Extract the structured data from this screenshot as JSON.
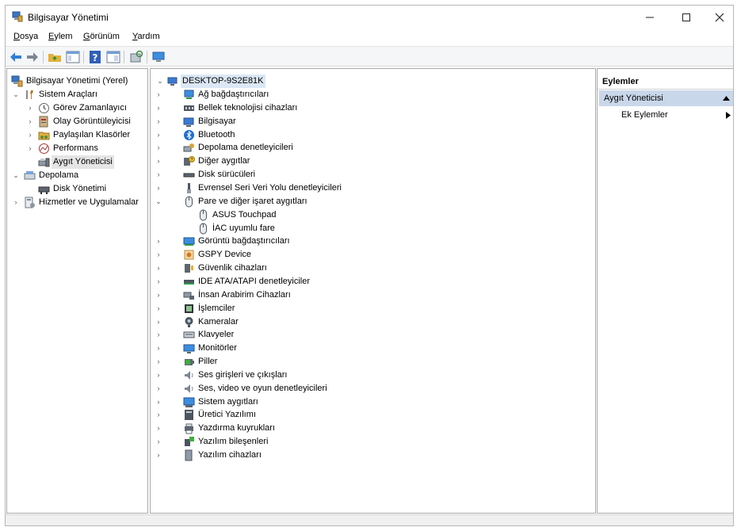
{
  "window": {
    "title": "Bilgisayar Yönetimi"
  },
  "menubar": [
    {
      "label": "Dosya",
      "mn": "D",
      "rest": "osya"
    },
    {
      "label": "Eylem",
      "mn": "E",
      "rest": "ylem"
    },
    {
      "label": "Görünüm",
      "mn": "G",
      "rest": "örünüm"
    },
    {
      "label": "Yardım",
      "mn": "Y",
      "rest": "ardım"
    }
  ],
  "left_tree": [
    {
      "label": "Bilgisayar Yönetimi (Yerel)",
      "icon": "computer-management-icon",
      "chev": "",
      "level": 0
    },
    {
      "label": "Sistem Araçları",
      "icon": "system-tools-icon",
      "chev": "v",
      "level": 1
    },
    {
      "label": "Görev Zamanlayıcı",
      "icon": "task-scheduler-icon",
      "chev": ">",
      "level": 2
    },
    {
      "label": "Olay Görüntüleyicisi",
      "icon": "event-viewer-icon",
      "chev": ">",
      "level": 2
    },
    {
      "label": "Paylaşılan Klasörler",
      "icon": "shared-folders-icon",
      "chev": ">",
      "level": 2
    },
    {
      "label": "Performans",
      "icon": "performance-icon",
      "chev": ">",
      "level": 2
    },
    {
      "label": "Aygıt Yöneticisi",
      "icon": "device-manager-icon",
      "chev": "",
      "level": 2,
      "selected": true
    },
    {
      "label": "Depolama",
      "icon": "storage-icon",
      "chev": "v",
      "level": 1
    },
    {
      "label": "Disk Yönetimi",
      "icon": "disk-management-icon",
      "chev": "",
      "level": 2
    },
    {
      "label": "Hizmetler ve Uygulamalar",
      "icon": "services-apps-icon",
      "chev": ">",
      "level": 1
    }
  ],
  "device_tree": {
    "root": {
      "label": "DESKTOP-9S2E81K",
      "icon": "computer-icon"
    },
    "items": [
      {
        "label": "Ağ bağdaştırıcıları",
        "icon": "network-adapter-icon",
        "chev": ">"
      },
      {
        "label": "Bellek teknolojisi cihazları",
        "icon": "memory-tech-icon",
        "chev": ">"
      },
      {
        "label": "Bilgisayar",
        "icon": "computer-icon",
        "chev": ">"
      },
      {
        "label": "Bluetooth",
        "icon": "bluetooth-icon",
        "chev": ">"
      },
      {
        "label": "Depolama denetleyicileri",
        "icon": "storage-controller-icon",
        "chev": ">"
      },
      {
        "label": "Diğer aygıtlar",
        "icon": "other-devices-icon",
        "chev": ">"
      },
      {
        "label": "Disk sürücüleri",
        "icon": "disk-drive-icon",
        "chev": ">"
      },
      {
        "label": "Evrensel Seri Veri Yolu denetleyicileri",
        "icon": "usb-icon",
        "chev": ">"
      },
      {
        "label": "Pare ve diğer işaret aygıtları",
        "icon": "mouse-icon",
        "chev": "v"
      },
      {
        "label": "ASUS Touchpad",
        "icon": "mouse-icon",
        "chev": "",
        "child": true
      },
      {
        "label": "İAC uyumlu fare",
        "icon": "mouse-icon",
        "chev": "",
        "child": true
      },
      {
        "label": "Görüntü bağdaştırıcıları",
        "icon": "display-adapter-icon",
        "chev": ">"
      },
      {
        "label": "GSPY Device",
        "icon": "gspy-device-icon",
        "chev": ">"
      },
      {
        "label": "Güvenlik cihazları",
        "icon": "security-device-icon",
        "chev": ">"
      },
      {
        "label": "IDE ATA/ATAPI denetleyiciler",
        "icon": "ide-controller-icon",
        "chev": ">"
      },
      {
        "label": "İnsan Arabirim Cihazları",
        "icon": "hid-icon",
        "chev": ">"
      },
      {
        "label": "İşlemciler",
        "icon": "processor-icon",
        "chev": ">"
      },
      {
        "label": "Kameralar",
        "icon": "camera-icon",
        "chev": ">"
      },
      {
        "label": "Klavyeler",
        "icon": "keyboard-icon",
        "chev": ">"
      },
      {
        "label": "Monitörler",
        "icon": "monitor-icon",
        "chev": ">"
      },
      {
        "label": "Piller",
        "icon": "battery-icon",
        "chev": ">"
      },
      {
        "label": "Ses girişleri ve çıkışları",
        "icon": "audio-io-icon",
        "chev": ">"
      },
      {
        "label": "Ses, video ve oyun denetleyicileri",
        "icon": "sound-video-icon",
        "chev": ">"
      },
      {
        "label": "Sistem aygıtları",
        "icon": "system-devices-icon",
        "chev": ">"
      },
      {
        "label": "Üretici Yazılımı",
        "icon": "firmware-icon",
        "chev": ">"
      },
      {
        "label": "Yazdırma kuyrukları",
        "icon": "print-queue-icon",
        "chev": ">"
      },
      {
        "label": "Yazılım bileşenleri",
        "icon": "software-components-icon",
        "chev": ">"
      },
      {
        "label": "Yazılım cihazları",
        "icon": "software-devices-icon",
        "chev": ">"
      }
    ]
  },
  "actions": {
    "header": "Eylemler",
    "section": "Aygıt Yöneticisi",
    "item": "Ek Eylemler"
  },
  "colors": {
    "accent": "#1a73c9",
    "selected_row": "#e5e5e5",
    "action_section": "#c9d7ea"
  }
}
